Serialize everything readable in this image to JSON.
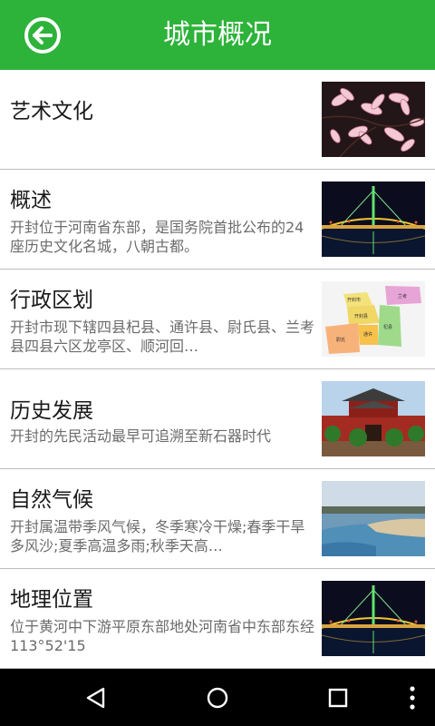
{
  "header": {
    "title": "城市概况",
    "back_icon": "back-arrow-icon",
    "bg_color": "#2db33a"
  },
  "items": [
    {
      "title": "艺术文化",
      "desc": "",
      "thumb": "magnolia-flowers-image"
    },
    {
      "title": "概述",
      "desc": "开封位于河南省东部，是国务院首批公布的24座历史文化名城，八朝古都。",
      "thumb": "night-bridge-image"
    },
    {
      "title": "行政区划",
      "desc": "开封市现下辖四县杞县、通许县、尉氏县、兰考县四县六区龙亭区、顺河回…",
      "thumb": "district-map-image",
      "map_labels": [
        "开封市",
        "兰考",
        "开封县",
        "杞县",
        "通许",
        "尉氏"
      ]
    },
    {
      "title": "历史发展",
      "desc": "开封的先民活动最早可追溯至新石器时代",
      "thumb": "city-gate-image"
    },
    {
      "title": "自然气候",
      "desc": "开封属温带季风气候，冬季寒冷干燥;春季干旱多风沙;夏季高温多雨;秋季天高…",
      "thumb": "river-landscape-image"
    },
    {
      "title": "地理位置",
      "desc": "位于黄河中下游平原东部地处河南省中东部东经113°52'15",
      "thumb": "night-bridge-image"
    }
  ],
  "navbar": {
    "back_icon": "triangle-back-icon",
    "home_icon": "circle-home-icon",
    "recents_icon": "square-recents-icon",
    "menu_icon": "vertical-dots-menu-icon"
  }
}
